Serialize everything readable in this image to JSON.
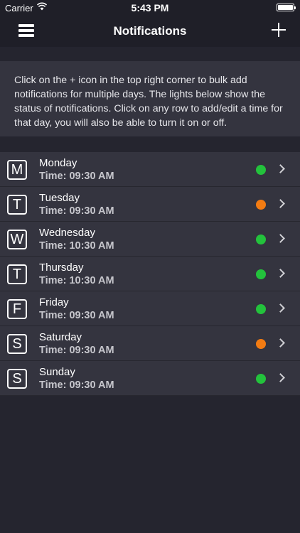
{
  "status_bar": {
    "carrier": "Carrier",
    "time": "5:43 PM"
  },
  "nav": {
    "title": "Notifications",
    "menu_icon": "hamburger-menu-icon",
    "add_icon": "plus-icon"
  },
  "info": {
    "text": "Click on the + icon in the top right corner to bulk add notifications for multiple days. The lights below show the status of notifications. Click on any row to add/edit a time for that day, you will also be able to turn it on or off."
  },
  "colors": {
    "status_on": "#23c23c",
    "status_pending": "#f27b12"
  },
  "days": [
    {
      "letter": "M",
      "name": "Monday",
      "time": "Time: 09:30 AM",
      "status": "on"
    },
    {
      "letter": "T",
      "name": "Tuesday",
      "time": "Time: 09:30 AM",
      "status": "pending"
    },
    {
      "letter": "W",
      "name": "Wednesday",
      "time": "Time: 10:30 AM",
      "status": "on"
    },
    {
      "letter": "T",
      "name": "Thursday",
      "time": "Time: 10:30 AM",
      "status": "on"
    },
    {
      "letter": "F",
      "name": "Friday",
      "time": "Time: 09:30 AM",
      "status": "on"
    },
    {
      "letter": "S",
      "name": "Saturday",
      "time": "Time: 09:30 AM",
      "status": "pending"
    },
    {
      "letter": "S",
      "name": "Sunday",
      "time": "Time: 09:30 AM",
      "status": "on"
    }
  ]
}
